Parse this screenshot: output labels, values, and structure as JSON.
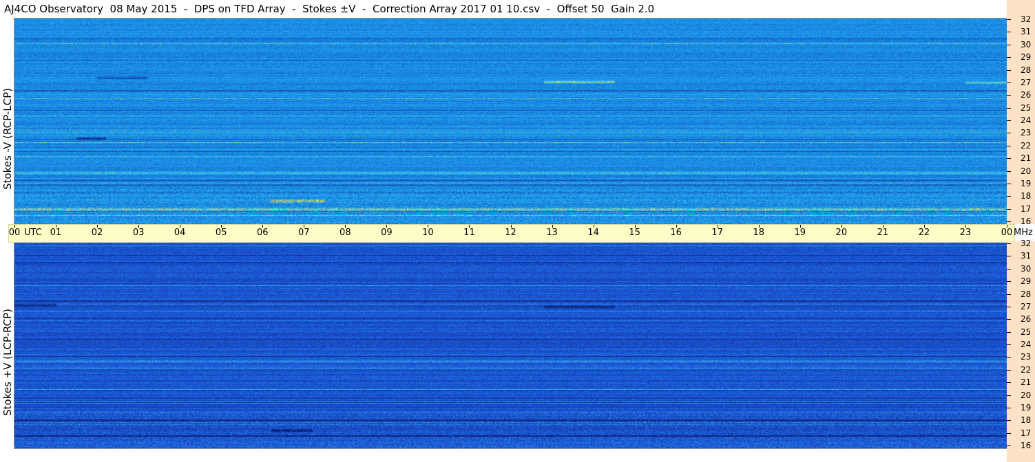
{
  "title": "AJ4CO Observatory  08 May 2015  -  DPS on TFD Array  -  Stokes ±V  -  Correction Array 2017 01 10.csv  -  Offset 50  Gain 2.0",
  "chart_data": {
    "type": "heatmap",
    "x_axis": {
      "unit": "UTC",
      "range": [
        0,
        24
      ],
      "tick_labels": [
        "00",
        "01",
        "02",
        "03",
        "04",
        "05",
        "06",
        "07",
        "08",
        "09",
        "10",
        "11",
        "12",
        "13",
        "14",
        "15",
        "16",
        "17",
        "18",
        "19",
        "20",
        "21",
        "22",
        "23",
        "00"
      ]
    },
    "y_axis": {
      "unit": "MHz",
      "range": [
        16,
        32
      ],
      "tick_labels": [
        "32",
        "31",
        "30",
        "29",
        "28",
        "27",
        "26",
        "25",
        "24",
        "23",
        "22",
        "21",
        "20",
        "19",
        "18",
        "17",
        "16"
      ]
    },
    "panels": [
      {
        "label": "Stokes -V (RCP-LCP)",
        "colors": {
          "base": "#1a8ce8",
          "light": "#2bbcf2",
          "dark": "#0a2a8a",
          "hot": "#f5f03a",
          "red": "#e6343a"
        },
        "features": [
          {
            "mhz": 17.2,
            "utc_start": 0.0,
            "utc_end": 24.0,
            "intensity": 0.9
          },
          {
            "mhz": 17.8,
            "utc_start": 6.2,
            "utc_end": 7.5,
            "intensity": 1.0
          },
          {
            "mhz": 27.1,
            "utc_start": 12.8,
            "utc_end": 14.5,
            "intensity": 0.9
          },
          {
            "mhz": 27.0,
            "utc_start": 23.0,
            "utc_end": 24.0,
            "intensity": 0.8
          },
          {
            "mhz": 22.7,
            "utc_start": 1.5,
            "utc_end": 2.2,
            "intensity": -0.9
          },
          {
            "mhz": 27.4,
            "utc_start": 2.0,
            "utc_end": 3.2,
            "intensity": -0.7
          },
          {
            "mhz": 20.0,
            "utc_start": 0.0,
            "utc_end": 24.0,
            "intensity": 0.6
          }
        ]
      },
      {
        "label": "Stokes +V (LCP-RCP)",
        "colors": {
          "base": "#1a52d6",
          "light": "#2a8fe6",
          "dark": "#0a1a66",
          "hot": "#4fd8ec",
          "red": "#e6343a"
        },
        "features": [
          {
            "mhz": 17.0,
            "utc_start": 0.0,
            "utc_end": 24.0,
            "intensity": -0.9
          },
          {
            "mhz": 17.4,
            "utc_start": 6.2,
            "utc_end": 7.2,
            "intensity": -1.0
          },
          {
            "mhz": 27.0,
            "utc_start": 12.8,
            "utc_end": 14.5,
            "intensity": -0.9
          },
          {
            "mhz": 27.2,
            "utc_start": 0.0,
            "utc_end": 1.0,
            "intensity": -0.8
          },
          {
            "mhz": 22.8,
            "utc_start": 0.0,
            "utc_end": 24.0,
            "intensity": 0.6
          },
          {
            "mhz": 18.2,
            "utc_start": 0.0,
            "utc_end": 24.0,
            "intensity": -0.7
          }
        ]
      }
    ]
  }
}
